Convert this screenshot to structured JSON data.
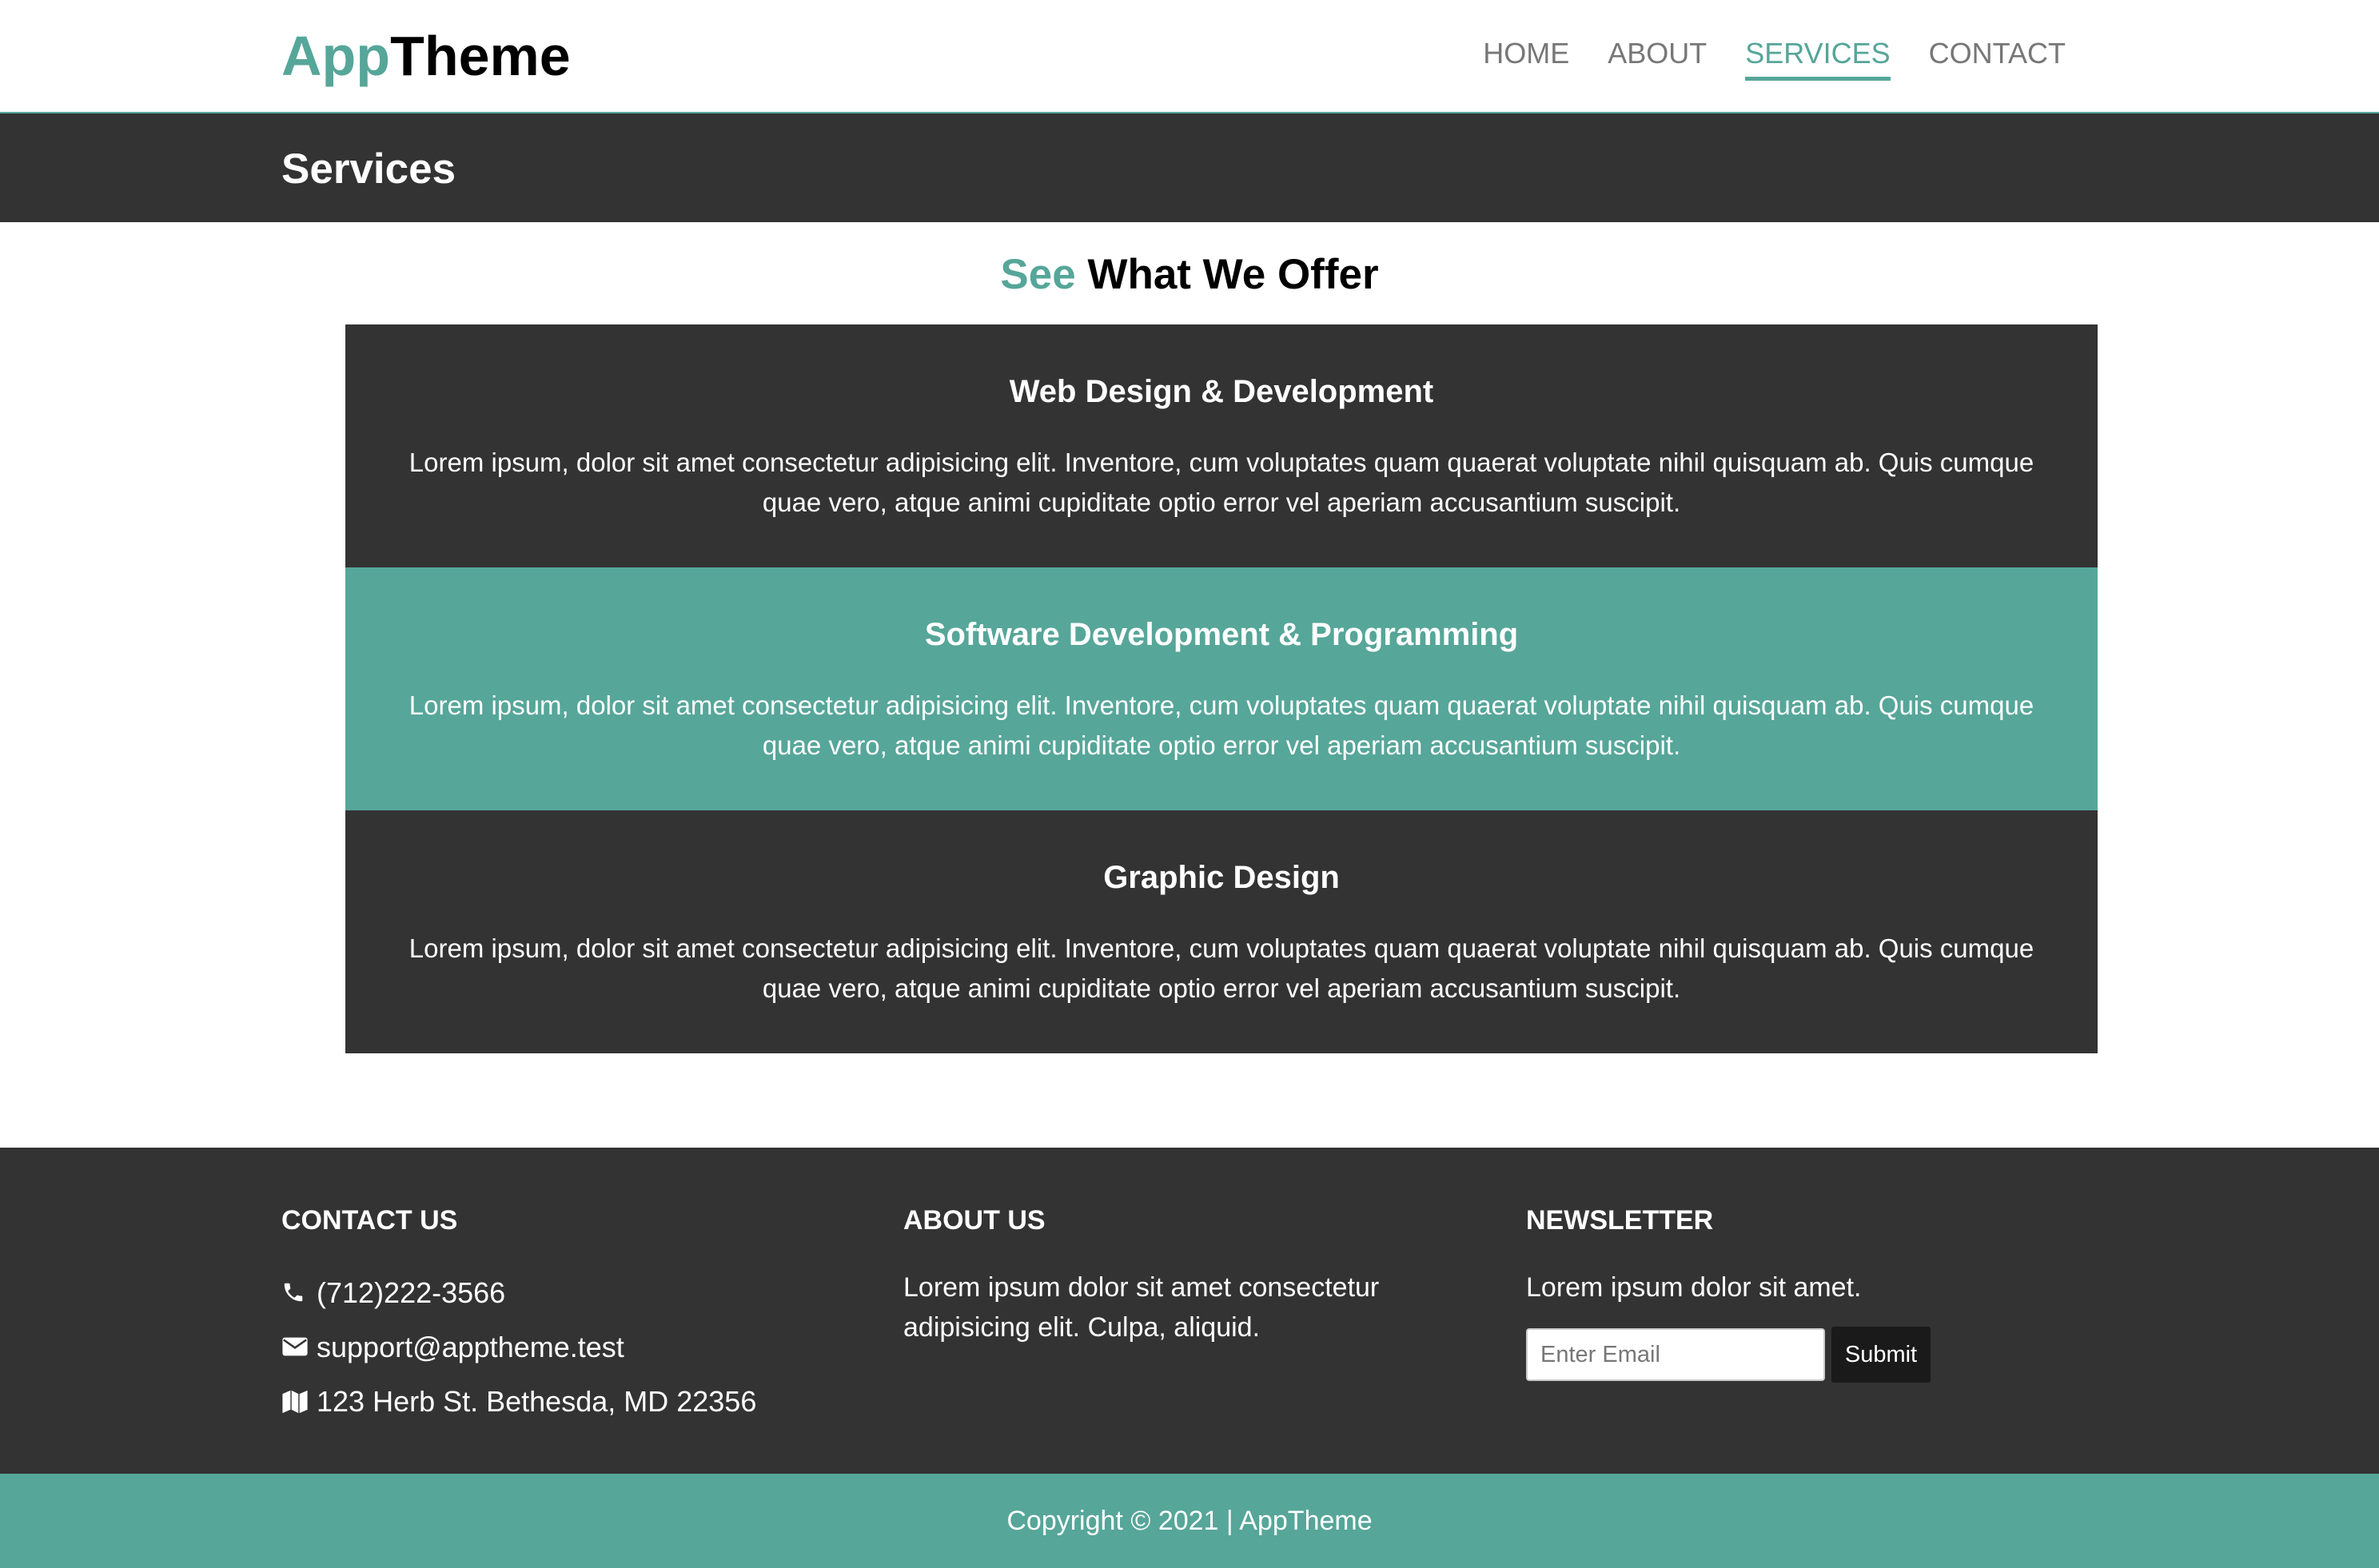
{
  "header": {
    "logo_accent": "App",
    "logo_main": "Theme",
    "nav": [
      {
        "label": "HOME"
      },
      {
        "label": "ABOUT"
      },
      {
        "label": "SERVICES"
      },
      {
        "label": "CONTACT"
      }
    ],
    "active_nav": "SERVICES"
  },
  "title_bar": {
    "title": "Services"
  },
  "services_section": {
    "heading_accent": "See",
    "heading_main": "What We Offer",
    "items": [
      {
        "title": "Web Design & Development",
        "text": "Lorem ipsum, dolor sit amet consectetur adipisicing elit. Inventore, cum voluptates quam quaerat voluptate nihil quisquam ab. Quis cumque quae vero, atque animi cupiditate optio error vel aperiam accusantium suscipit."
      },
      {
        "title": "Software Development & Programming",
        "text": "Lorem ipsum, dolor sit amet consectetur adipisicing elit. Inventore, cum voluptates quam quaerat voluptate nihil quisquam ab. Quis cumque quae vero, atque animi cupiditate optio error vel aperiam accusantium suscipit."
      },
      {
        "title": "Graphic Design",
        "text": "Lorem ipsum, dolor sit amet consectetur adipisicing elit. Inventore, cum voluptates quam quaerat voluptate nihil quisquam ab. Quis cumque quae vero, atque animi cupiditate optio error vel aperiam accusantium suscipit."
      }
    ]
  },
  "footer": {
    "contact": {
      "heading": "CONTACT US",
      "phone": "(712)222-3566",
      "email": "support@apptheme.test",
      "address": "123 Herb St. Bethesda, MD 22356"
    },
    "about": {
      "heading": "ABOUT US",
      "text": "Lorem ipsum dolor sit amet consectetur adipisicing elit. Culpa, aliquid."
    },
    "newsletter": {
      "heading": "NEWSLETTER",
      "text": "Lorem ipsum dolor sit amet.",
      "email_placeholder": "Enter Email",
      "submit_label": "Submit"
    },
    "copyright": "Copyright © 2021 | AppTheme"
  },
  "colors": {
    "accent": "#56a699",
    "dark": "#333333",
    "white": "#ffffff"
  },
  "icons": [
    "phone-icon",
    "envelope-icon",
    "map-icon"
  ]
}
